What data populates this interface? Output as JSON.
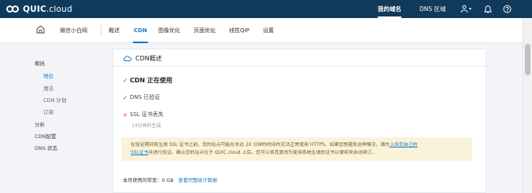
{
  "brand": {
    "bold": "QUIC",
    "light": ".cloud"
  },
  "topnav": {
    "domains": "我的域名",
    "dns_zones": "DNS 区域",
    "user_caret": "▾"
  },
  "subbar": {
    "site_name": "微信小白网",
    "tabs": [
      "概述",
      "CDN",
      "图像优化",
      "页面优化",
      "线性QIP",
      "设置"
    ]
  },
  "sidebar": {
    "items": [
      {
        "label": "概括"
      },
      {
        "label": "地位"
      },
      {
        "label": "用法"
      },
      {
        "label": "CDN 计划"
      },
      {
        "label": "订阅"
      },
      {
        "label": "分析"
      },
      {
        "label": "CDN配置"
      },
      {
        "label": "DNS 状态"
      }
    ]
  },
  "card": {
    "title": "CDN概述",
    "status_main": "CDN 正在使用",
    "dns_verified": "DNS 已验证",
    "ssl_missing": "SSL 证书丢失",
    "gen_note": "14分钟后生成",
    "notice_line1": "在验证期间和生成 SSL 证书之前，您的站点可能在长达 20 分钟的时间内无法正常使用 HTTPS。如果您想避免这种情况，请先",
    "notice_link1": "上传您自己的",
    "notice_link2": "SSL证书",
    "notice_line2": "并进行验证。确认您的站点位于 QUIC.cloud 上后，您可以将其更改为使用系统生成的证书以便将来自动续订。",
    "usage_label": "本月使用的带宽：0 GB",
    "usage_link": "查看完整统计数据"
  },
  "marks": {
    "check": "✓",
    "cross": "×"
  },
  "colors": {
    "topbar": "#103a5c",
    "accent": "#1777c4",
    "notice_bg": "#fbf3d9",
    "error": "#d9534f"
  }
}
